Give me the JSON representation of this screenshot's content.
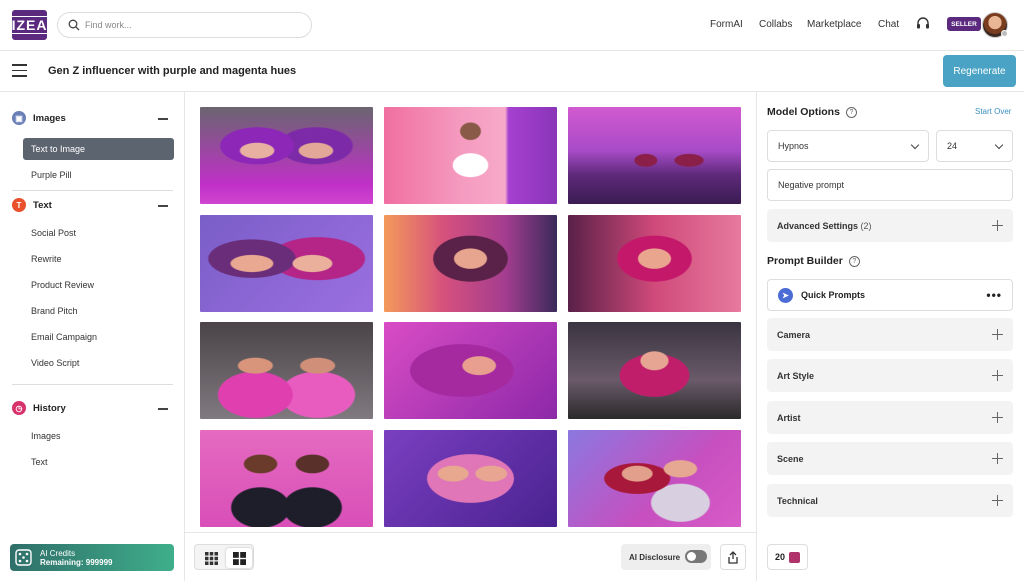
{
  "header": {
    "logo_text": "IZEA",
    "search_placeholder": "Find work...",
    "nav": [
      "FormAI",
      "Collabs",
      "Marketplace",
      "Chat"
    ],
    "seller_badge": "SELLER"
  },
  "subheader": {
    "title": "Gen Z influencer with purple and magenta hues",
    "regenerate_label": "Regenerate"
  },
  "sidebar": {
    "images": {
      "label": "Images",
      "items": [
        "Text to Image",
        "Purple Pill"
      ],
      "active": "Text to Image"
    },
    "text": {
      "label": "Text",
      "items": [
        "Social Post",
        "Rewrite",
        "Product Review",
        "Brand Pitch",
        "Email Campaign",
        "Video Script"
      ]
    },
    "history": {
      "label": "History",
      "items": [
        "Images",
        "Text"
      ]
    },
    "credits": {
      "line1": "AI Credits",
      "line2": "Remaining: 999999"
    }
  },
  "gallery": {
    "images": [
      "Two women with purple hair and sunglasses on city street",
      "Woman in white t-shirt with sunglasses on pink background",
      "Two women on purple mountain lake at sunset",
      "Two women with magenta hair close portrait",
      "Woman with dark purple hair in city",
      "Woman with magenta hair on street at dusk",
      "Two women with sunglasses in pink outfits on street",
      "Woman with flowing purple hair",
      "Woman with magenta hair in city",
      "Two women with dark curly hair on pink background",
      "Two women with pink hair on purple background",
      "Two women with red hair in jackets"
    ]
  },
  "bottom": {
    "ai_disclosure_label": "AI Disclosure",
    "ai_disclosure_on": false
  },
  "right_panel": {
    "model_options_label": "Model Options",
    "start_over_label": "Start Over",
    "model_value": "Hypnos",
    "count_value": "24",
    "negative_prompt_placeholder": "Negative prompt",
    "advanced_label": "Advanced Settings",
    "advanced_count": "(2)",
    "prompt_builder_label": "Prompt Builder",
    "quick_prompts_label": "Quick Prompts",
    "sections": [
      "Camera",
      "Art Style",
      "Artist",
      "Scene",
      "Technical"
    ],
    "credit_cost": "20"
  },
  "colors": {
    "brand": "#5b2a7e",
    "accent": "#4aa3c4",
    "images_icon": "#6b7fb8",
    "text_icon": "#e8512b",
    "history_icon": "#d8326d"
  }
}
